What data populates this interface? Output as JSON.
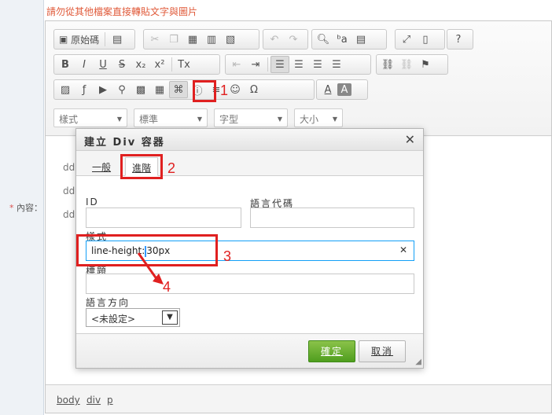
{
  "warning": "請勿從其他檔案直接轉貼文字與圖片",
  "field_label": "內容：",
  "field_required": "*",
  "toolbar": {
    "source_label": "原始碼",
    "bold": "B",
    "italic": "I",
    "underline": "U",
    "strike": "S",
    "subscript": "x₂",
    "superscript": "x²",
    "removeformat": "Tx",
    "omega": "Ω",
    "font_color": "A",
    "bg_color": "A"
  },
  "combos": {
    "styles": "樣式",
    "format": "標準",
    "font": "字型",
    "size": "大小"
  },
  "content_lines": [
    "ddd",
    "ddd",
    "ddd"
  ],
  "status_path": [
    "body",
    "div",
    "p"
  ],
  "dialog": {
    "title": "建立 Div 容器",
    "tabs": [
      "一般",
      "進階"
    ],
    "id_label": "ID",
    "lang_code_label": "語言代碼",
    "style_label": "樣式",
    "style_value_before": "line-height:",
    "style_value_after": "30px",
    "title_label": "標題",
    "dir_label": "語言方向",
    "dir_value": "<未設定>",
    "ok": "確定",
    "cancel": "取消"
  },
  "annotations": [
    "1",
    "2",
    "3",
    "4"
  ],
  "colors": {
    "annotation": "#e02020",
    "ok_button": "#4f9e1e",
    "warning_text": "#e05a3a"
  }
}
